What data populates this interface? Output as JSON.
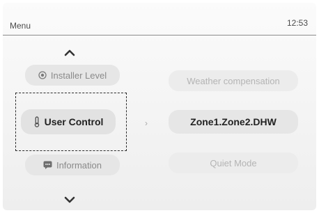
{
  "header": {
    "title": "Menu",
    "time": "12:53"
  },
  "left_menu": {
    "items": [
      {
        "label": "Installer Level",
        "icon": "eye-circle-icon"
      },
      {
        "label": "User Control",
        "icon": "thermometer-icon"
      },
      {
        "label": "Information",
        "icon": "chat-icon"
      }
    ],
    "selected": "User Control"
  },
  "right_menu": {
    "items": [
      {
        "label": "Weather compensation"
      },
      {
        "label": "Zone1.Zone2.DHW"
      },
      {
        "label": "Quiet Mode"
      }
    ]
  },
  "nav": {
    "arrow_right": "›"
  }
}
